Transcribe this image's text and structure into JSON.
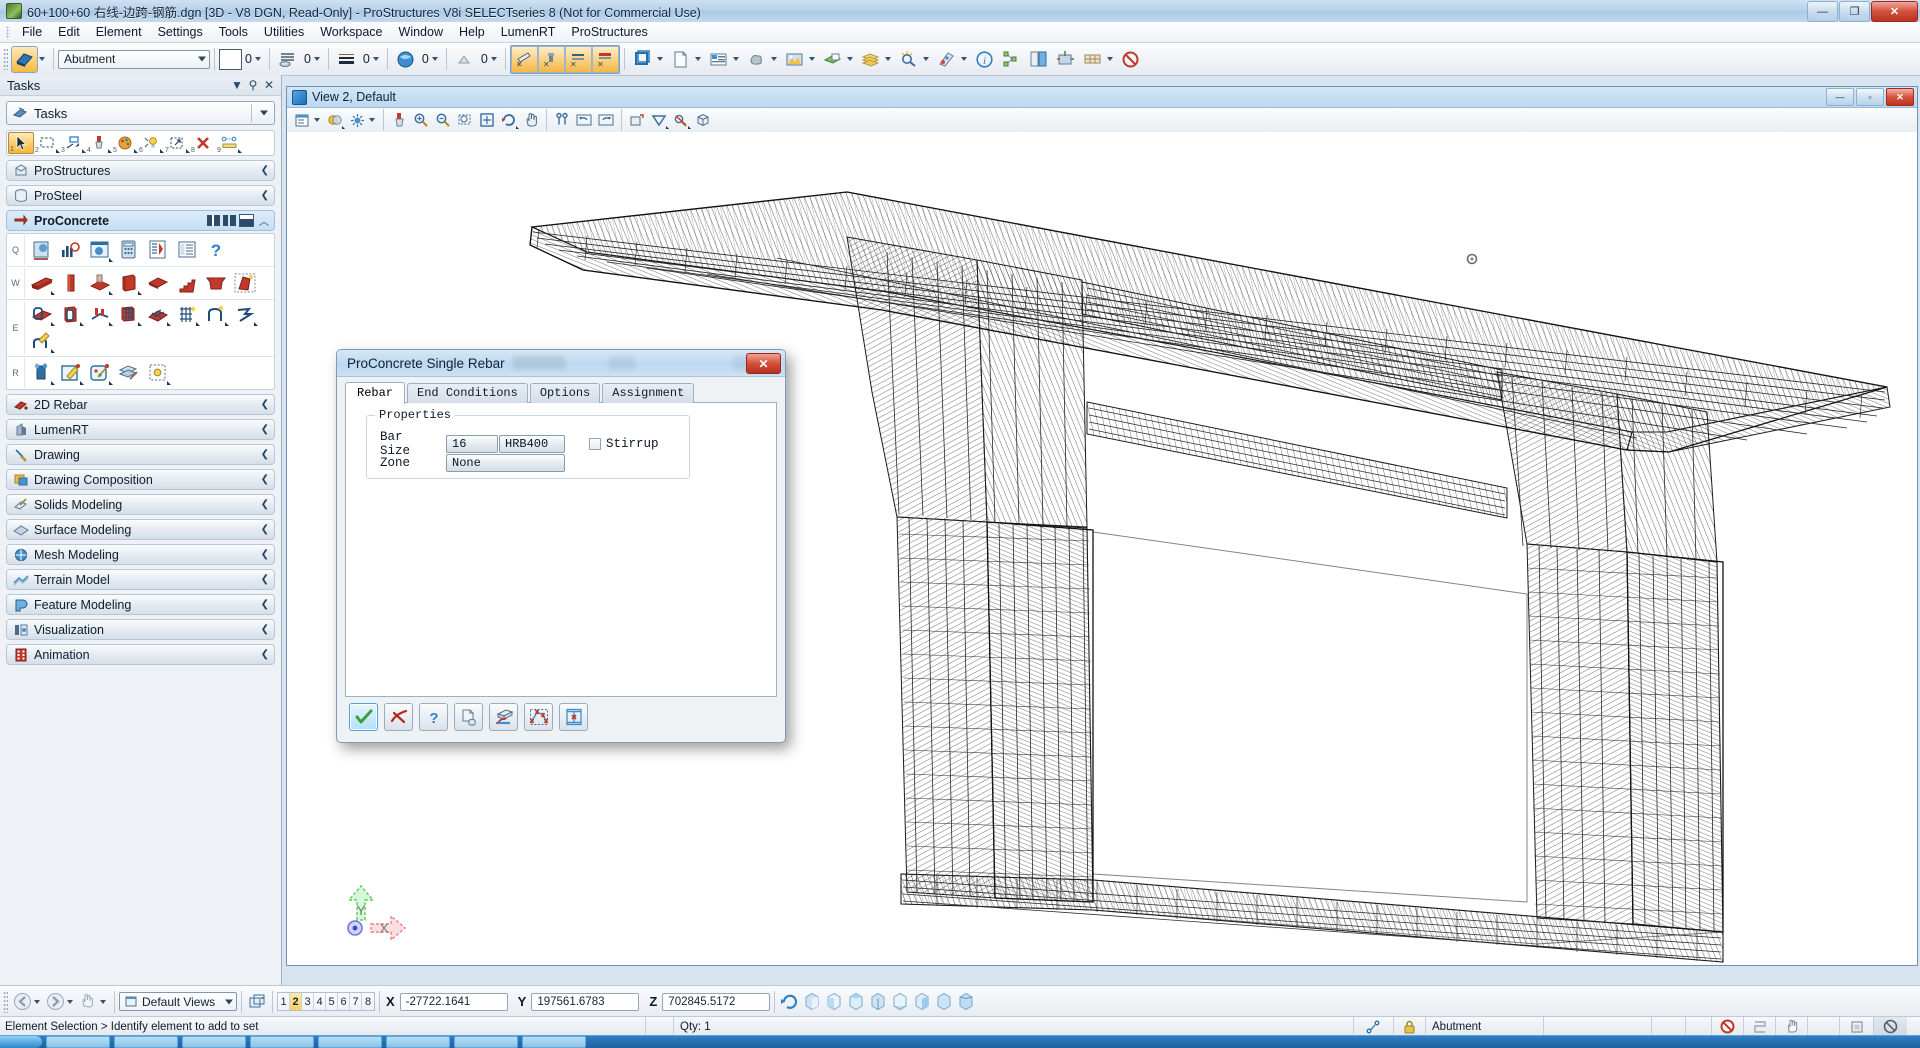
{
  "window": {
    "title": "60+100+60 右线-边跨-钢筋.dgn [3D - V8 DGN, Read-Only] - ProStructures V8i SELECTseries 8 (Not for Commercial Use)",
    "minimize": "—",
    "restore": "❐",
    "close": "✕"
  },
  "menu": {
    "items": [
      {
        "label": "File"
      },
      {
        "label": "Edit"
      },
      {
        "label": "Element"
      },
      {
        "label": "Settings"
      },
      {
        "label": "Tools"
      },
      {
        "label": "Utilities"
      },
      {
        "label": "Workspace"
      },
      {
        "label": "Window"
      },
      {
        "label": "Help"
      },
      {
        "label": "LumenRT"
      },
      {
        "label": "ProStructures"
      }
    ]
  },
  "attributes_toolbar": {
    "level_value": "Abutment",
    "color_value": "0",
    "style_value": "0",
    "weight_value": "0",
    "transparency_value": "0",
    "priority_value": "0"
  },
  "tasks_panel": {
    "title": "Tasks",
    "active_task": "Tasks",
    "tools": [
      {
        "key": "1",
        "name": "element-selection-tool"
      },
      {
        "key": "2",
        "name": "fence-tool"
      },
      {
        "key": "3",
        "name": "manipulate-tool"
      },
      {
        "key": "4",
        "name": "change-attributes-tool"
      },
      {
        "key": "5",
        "name": "color-tool"
      },
      {
        "key": "6",
        "name": "light-tool"
      },
      {
        "key": "7",
        "name": "move-tool"
      },
      {
        "key": "8",
        "name": "delete-tool"
      },
      {
        "key": "9",
        "name": "measure-tool"
      }
    ],
    "groups": [
      {
        "label": "ProStructures",
        "expanded": false
      },
      {
        "label": "ProSteel",
        "expanded": false
      },
      {
        "label": "ProConcrete",
        "expanded": true
      }
    ],
    "proconcrete_rows": [
      {
        "key": "Q",
        "count": 7
      },
      {
        "key": "W",
        "count": 8
      },
      {
        "key": "E",
        "count": 9
      },
      {
        "key": "R",
        "count": 5
      }
    ],
    "items": [
      {
        "label": "2D Rebar"
      },
      {
        "label": "LumenRT"
      },
      {
        "label": "Drawing"
      },
      {
        "label": "Drawing Composition"
      },
      {
        "label": "Solids Modeling"
      },
      {
        "label": "Surface Modeling"
      },
      {
        "label": "Mesh Modeling"
      },
      {
        "label": "Terrain Model"
      },
      {
        "label": "Feature Modeling"
      },
      {
        "label": "Visualization"
      },
      {
        "label": "Animation"
      }
    ]
  },
  "view_window": {
    "title": "View 2, Default",
    "minimize": "—",
    "restore": "▫",
    "close": "✕",
    "axis": {
      "x": "X",
      "y": "Y"
    }
  },
  "dialog": {
    "title": "ProConcrete Single Rebar",
    "close": "✕",
    "tabs": [
      {
        "label": "Rebar",
        "selected": true
      },
      {
        "label": "End Conditions",
        "selected": false
      },
      {
        "label": "Options",
        "selected": false
      },
      {
        "label": "Assignment",
        "selected": false
      }
    ],
    "properties": {
      "legend": "Properties",
      "bar_size_label": "Bar Size",
      "bar_size_value": "16",
      "bar_grade_value": "HRB400",
      "stirrup_label": "Stirrup",
      "stirrup_checked": false,
      "zone_label": "Zone",
      "zone_value": "None"
    },
    "footer_buttons": [
      {
        "name": "apply-ok-button",
        "icon": "check-icon",
        "active": true
      },
      {
        "name": "cancel-button",
        "icon": "red-x-icon",
        "active": false
      },
      {
        "name": "help-button",
        "icon": "question-mark-icon",
        "active": false
      },
      {
        "name": "copy-properties-button",
        "icon": "copy-page-icon",
        "active": false
      },
      {
        "name": "place-on-solid-button",
        "icon": "solid-bar-icon",
        "active": false
      },
      {
        "name": "place-by-points-button",
        "icon": "polyline-points-icon",
        "active": false
      },
      {
        "name": "place-between-button",
        "icon": "between-faces-icon",
        "active": false
      }
    ]
  },
  "view_bar": {
    "default_views": "Default Views",
    "view_numbers": [
      "1",
      "2",
      "3",
      "4",
      "5",
      "6",
      "7",
      "8"
    ],
    "active_view": "2",
    "x_label": "X",
    "x_value": "-27722.1641",
    "y_label": "Y",
    "y_value": "197561.6783",
    "z_label": "Z",
    "z_value": "702845.5172"
  },
  "status_bar": {
    "message": "Element Selection > Identify element to add to set",
    "qty": "Qty: 1",
    "level": "Abutment"
  },
  "colors": {
    "accent_blue": "#2f7fc6",
    "title_blue": "#b9d2ea",
    "dialog_header": "#bdd8ef",
    "close_red": "#d4503a",
    "highlight_orange": "#fbcb68",
    "model_line": "#1a1a1a",
    "axis_y_green": "#69d06a",
    "axis_x_red": "#e8707a"
  }
}
